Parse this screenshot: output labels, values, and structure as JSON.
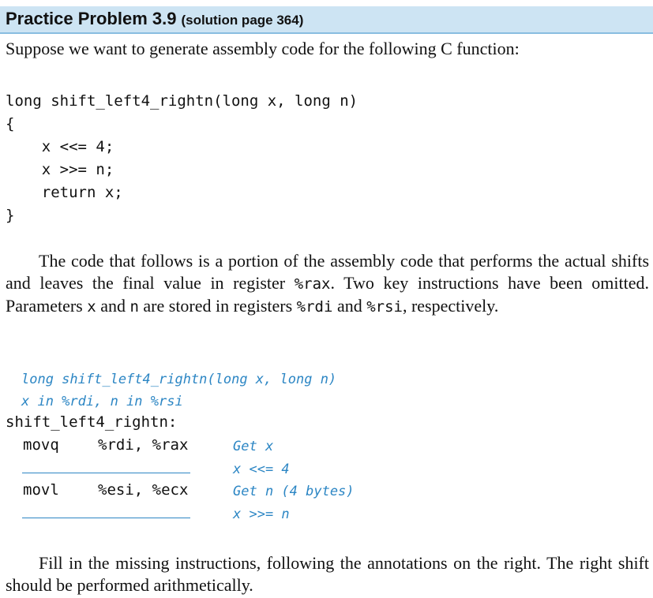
{
  "header": {
    "title": "Practice Problem 3.9",
    "solution_ref": "(solution page 364)"
  },
  "intro": "Suppose we want to generate assembly code for the following C function:",
  "c_code": [
    "long shift_left4_rightn(long x, long n)",
    "{",
    "    x <<= 4;",
    "    x >>= n;",
    "    return x;",
    "}"
  ],
  "paragraph": {
    "p1": "The code that follows is a portion of the assembly code that performs the actual shifts and leaves the final value in register ",
    "rax": "%rax",
    "p2": ". Two key instructions have been omitted. Parameters ",
    "x": "x",
    "p3": " and ",
    "n": "n",
    "p4": " are stored in registers ",
    "rdi": "%rdi",
    "p5": " and ",
    "rsi": "%rsi",
    "p6": ", respectively."
  },
  "asm": {
    "signature": "long shift_left4_rightn(long x, long n)",
    "params": "x in %rdi, n in %rsi",
    "label": "shift_left4_rightn:",
    "rows": [
      {
        "op": "movq",
        "args": "%rdi, %rax",
        "comment": "Get x"
      },
      {
        "op": "",
        "args": "",
        "comment": "x <<= 4"
      },
      {
        "op": "movl",
        "args": "%esi, %ecx",
        "comment": "Get n (4 bytes)"
      },
      {
        "op": "",
        "args": "",
        "comment": "x >>= n"
      }
    ]
  },
  "closing": "Fill in the missing instructions, following the annotations on the right. The right shift should be performed arithmetically."
}
